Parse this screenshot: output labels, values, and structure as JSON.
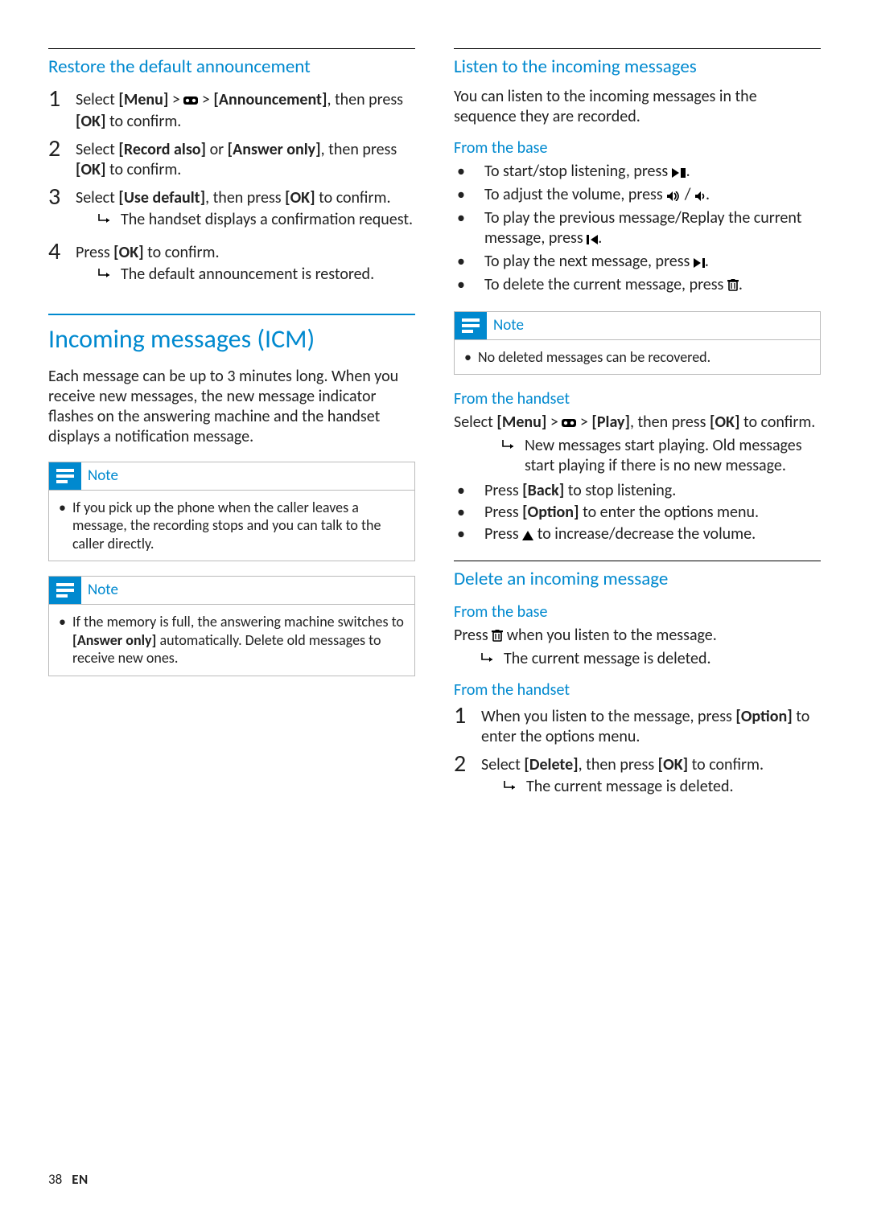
{
  "page": {
    "number": "38",
    "lang": "EN"
  },
  "labels": {
    "note": "Note",
    "menu": "[Menu]",
    "ok": "[OK]",
    "announcement": "[Announcement]",
    "record_also": "[Record also]",
    "answer_only_bold": "[Answer only]",
    "answer_only_plain": "[Answer only]",
    "use_default": "[Use default]",
    "play": "[Play]",
    "back": "[Back]",
    "option": "[Option]",
    "delete": "[Delete]"
  },
  "left": {
    "sec1_title": "Restore the default announcement",
    "step1_a": "Select ",
    "step1_b": " > ",
    "step1_c": " > ",
    "step1_d": ", then press ",
    "step1_e": " to confirm.",
    "step2_a": "Select ",
    "step2_b": " or ",
    "step2_c": ", then press ",
    "step2_d": " to confirm.",
    "step3_a": "Select ",
    "step3_b": ", then press ",
    "step3_c": " to confirm.",
    "step3_res": "The handset displays a confirmation request.",
    "step4_a": "Press ",
    "step4_b": " to confirm.",
    "step4_res": "The default announcement is restored.",
    "big_title": "Incoming messages (ICM)",
    "intro": "Each message can be up to 3 minutes long. When you receive new messages, the new message indicator flashes on the answering machine and the handset displays a notification message.",
    "note1": "If you pick up the phone when the caller leaves a message, the recording stops and you can talk to the caller directly.",
    "note2_a": "If the memory is full, the answering machine switches to ",
    "note2_b": " automatically. Delete old messages to receive new ones."
  },
  "right": {
    "sec1_title": "Listen to the incoming messages",
    "intro": "You can listen to the incoming messages in the sequence they are recorded.",
    "sub_base": "From the base",
    "b1_a": "To start/stop listening, press ",
    "b1_b": ".",
    "b2_a": "To adjust the volume, press ",
    "b2_b": " / ",
    "b2_c": ".",
    "b3_a": "To play the previous message/Replay the current message, press ",
    "b3_b": ".",
    "b4_a": "To play the next message, press ",
    "b4_b": ".",
    "b5_a": "To delete the current message, press ",
    "b5_b": ".",
    "note": "No deleted messages can be recovered.",
    "sub_handset": "From the handset",
    "hs_a": "Select ",
    "hs_b": " > ",
    "hs_c": " > ",
    "hs_d": ", then press ",
    "hs_e": " to confirm.",
    "hs_res": "New messages start playing. Old messages start playing if there is no new message.",
    "hb1_a": "Press ",
    "hb1_b": " to stop listening.",
    "hb2_a": "Press ",
    "hb2_b": " to enter the options menu.",
    "hb3_a": "Press ",
    "hb3_b": " to increase/decrease the volume.",
    "sec2_title": "Delete an incoming message",
    "del_base_a": "Press ",
    "del_base_b": " when you listen to the message.",
    "del_base_res": "The current message is deleted.",
    "del_hs1_a": "When you listen to the message, press ",
    "del_hs1_b": " to enter the options menu.",
    "del_hs2_a": "Select ",
    "del_hs2_b": ", then press ",
    "del_hs2_c": " to confirm.",
    "del_hs2_res": "The current message is deleted."
  }
}
